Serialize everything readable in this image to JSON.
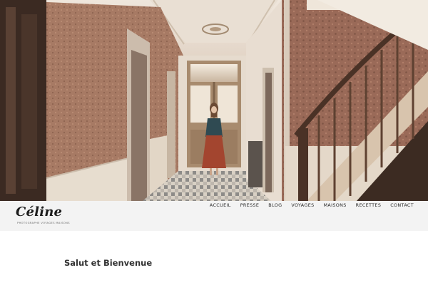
{
  "site": {
    "logo_name": "Céline",
    "logo_tagline": "PHOTOGRAPHE VOYAGES MAISONS"
  },
  "nav": {
    "items": [
      "ACCUEIL",
      "PRESSE",
      "BLOG",
      "VOYAGES",
      "MAISONS",
      "RECETTES",
      "CONTACT"
    ]
  },
  "main": {
    "welcome_title": "Salut et Bienvenue"
  }
}
